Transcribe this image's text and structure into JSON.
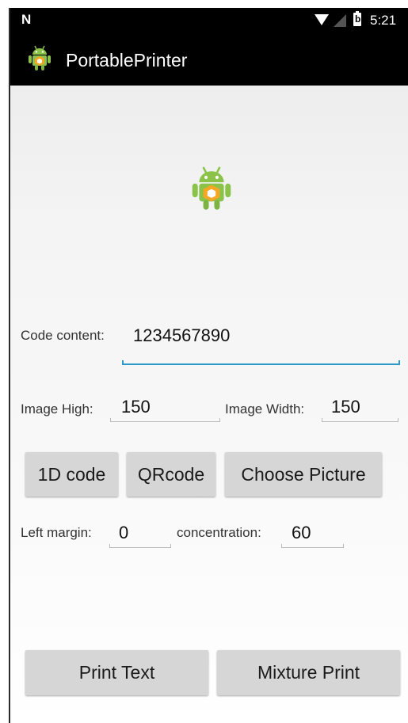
{
  "status_bar": {
    "carrier_glyph": "N",
    "battery_glyph": "b",
    "time": "5:21"
  },
  "app_bar": {
    "title": "PortablePrinter",
    "icon": "android-robot-icon"
  },
  "center_image": {
    "icon": "android-robot-icon"
  },
  "code_content": {
    "label": "Code content:",
    "value": "1234567890"
  },
  "image_high": {
    "label": "Image High:",
    "value": "150"
  },
  "image_width": {
    "label": "Image Width:",
    "value": "150"
  },
  "code_buttons": {
    "one_d": "1D code",
    "qr": "QRcode",
    "choose_picture": "Choose Picture"
  },
  "left_margin": {
    "label": "Left margin:",
    "value": "0"
  },
  "concentration": {
    "label": "concentration:",
    "value": "60"
  },
  "print_buttons": {
    "print_text": "Print Text",
    "mixture_print": "Mixture Print"
  },
  "colors": {
    "status_bar": "#000000",
    "app_bar": "#000000",
    "active_underline": "#2b9ac9",
    "button_bg": "#d6d6d6",
    "android_green": "#8bc34a"
  }
}
